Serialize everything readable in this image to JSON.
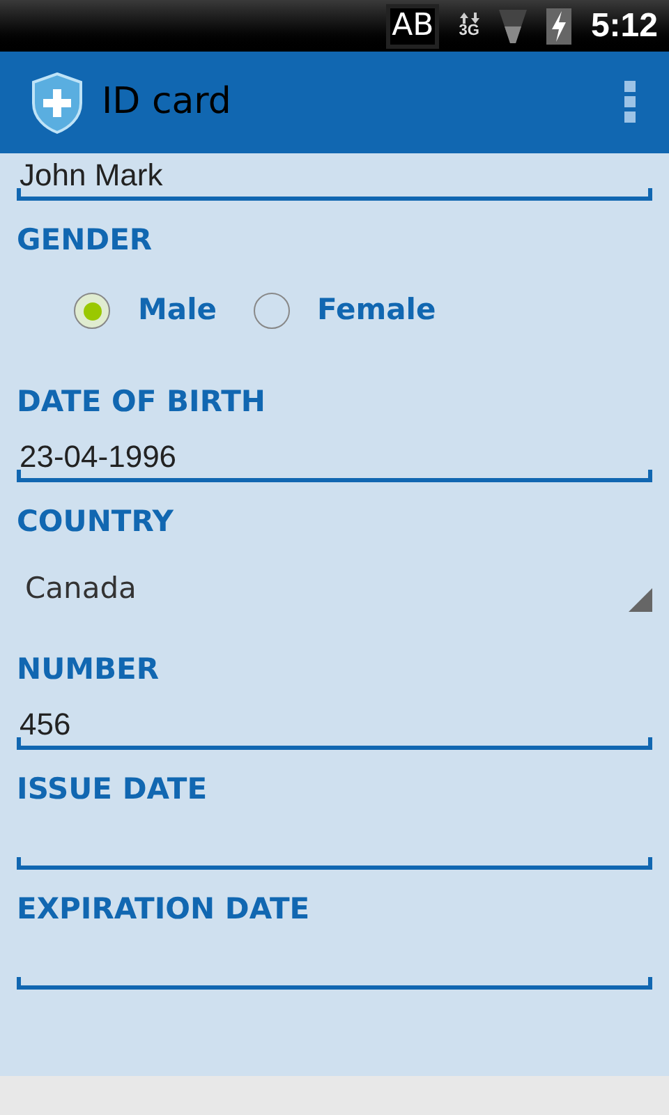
{
  "status_bar": {
    "keyboard_badge": "AB",
    "network": "3G",
    "time": "5:12"
  },
  "app_bar": {
    "title": "ID card"
  },
  "fields": [
    {
      "kind": "text",
      "value": "John Mark"
    },
    {
      "kind": "radio",
      "label": "GENDER",
      "options": [
        {
          "label": "Male",
          "selected": true
        },
        {
          "label": "Female",
          "selected": false
        }
      ]
    },
    {
      "kind": "text",
      "label": "DATE OF BIRTH",
      "value": "23-04-1996"
    },
    {
      "kind": "spinner",
      "label": "COUNTRY",
      "value": "Canada"
    },
    {
      "kind": "text",
      "label": "NUMBER",
      "value": "456"
    },
    {
      "kind": "text",
      "label": "ISSUE DATE"
    },
    {
      "kind": "text",
      "label": "EXPIRATION DATE"
    }
  ]
}
